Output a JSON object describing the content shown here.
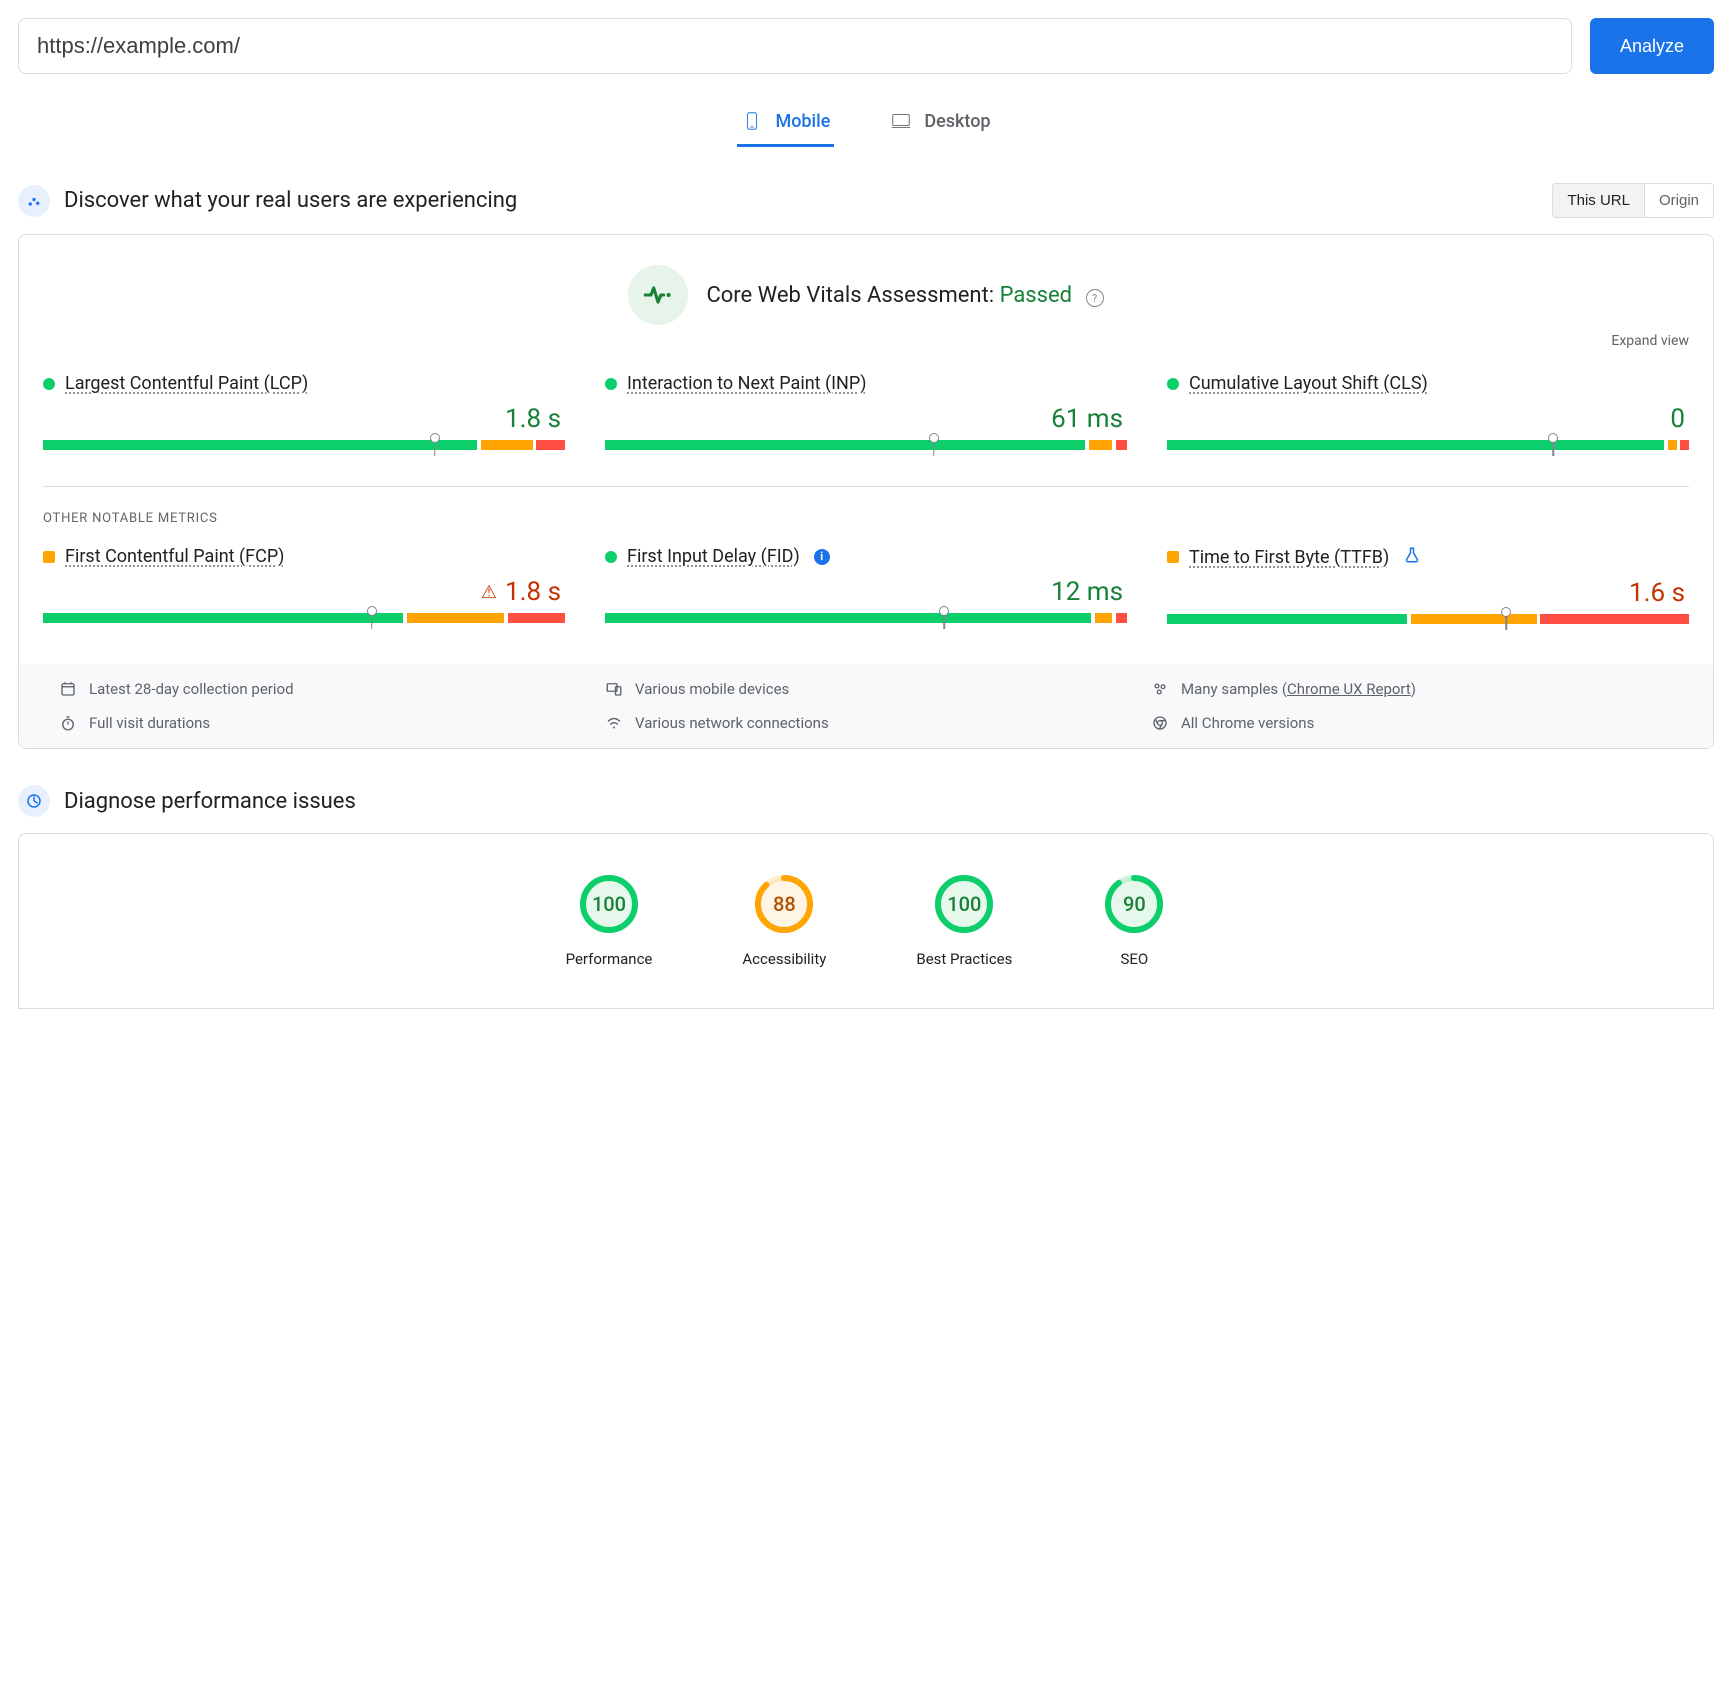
{
  "url_input": {
    "value": "https://example.com/"
  },
  "analyze_label": "Analyze",
  "tabs": {
    "mobile": "Mobile",
    "desktop": "Desktop"
  },
  "field_data": {
    "heading": "Discover what your real users are experiencing",
    "seg_this_url": "This URL",
    "seg_origin": "Origin",
    "assessment_label": "Core Web Vitals Assessment:",
    "assessment_status": "Passed",
    "expand_label": "Expand view",
    "other_label": "OTHER NOTABLE METRICS",
    "metrics": [
      {
        "name": "Largest Contentful Paint (LCP)",
        "value": "1.8 s",
        "status": "green",
        "dist": {
          "g": 76,
          "o": 9,
          "r": 5
        },
        "marker": 75,
        "warn": false
      },
      {
        "name": "Interaction to Next Paint (INP)",
        "value": "61 ms",
        "status": "green",
        "dist": {
          "g": 84,
          "o": 4,
          "r": 2
        },
        "marker": 63,
        "warn": false
      },
      {
        "name": "Cumulative Layout Shift (CLS)",
        "value": "0",
        "status": "green",
        "dist": {
          "g": 87,
          "o": 1.5,
          "r": 1.5
        },
        "marker": 74,
        "warn": false
      }
    ],
    "other_metrics": [
      {
        "name": "First Contentful Paint (FCP)",
        "value": "1.8 s",
        "status": "orange",
        "dist": {
          "g": 63,
          "o": 17,
          "r": 10
        },
        "marker": 63,
        "warn": true
      },
      {
        "name": "First Input Delay (FID)",
        "value": "12 ms",
        "status": "green",
        "info": true,
        "dist": {
          "g": 85,
          "o": 3,
          "r": 2
        },
        "marker": 65,
        "warn": false
      },
      {
        "name": "Time to First Byte (TTFB)",
        "value": "1.6 s",
        "status": "orange",
        "flask": true,
        "dist": {
          "g": 42,
          "o": 22,
          "r": 26
        },
        "marker": 65,
        "warn": false
      }
    ],
    "footer": {
      "period": "Latest 28-day collection period",
      "devices": "Various mobile devices",
      "samples_prefix": "Many samples (",
      "samples_link": "Chrome UX Report",
      "samples_suffix": ")",
      "durations": "Full visit durations",
      "network": "Various network connections",
      "versions": "All Chrome versions"
    }
  },
  "lighthouse": {
    "heading": "Diagnose performance issues",
    "gauges": [
      {
        "label": "Performance",
        "score": 100,
        "color": "green"
      },
      {
        "label": "Accessibility",
        "score": 88,
        "color": "orange"
      },
      {
        "label": "Best Practices",
        "score": 100,
        "color": "green"
      },
      {
        "label": "SEO",
        "score": 90,
        "color": "green"
      }
    ]
  }
}
